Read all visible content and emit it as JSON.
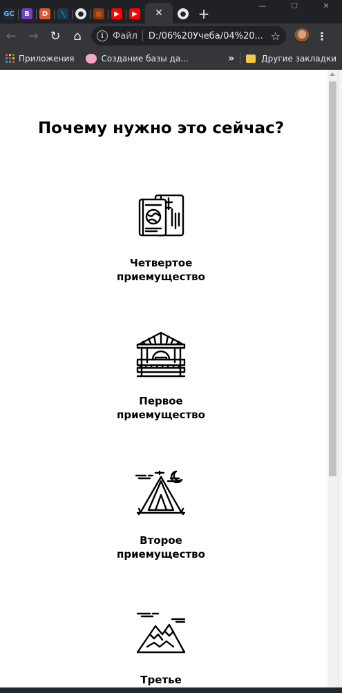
{
  "browser": {
    "tabs": [
      {
        "name": "gc",
        "text": "GC",
        "color": "#1f2b38",
        "fg": "#6fb3e8"
      },
      {
        "name": "bootstrap",
        "text": "B",
        "color": "#6f42c1",
        "fg": "#ffffff"
      },
      {
        "name": "duckduckgo",
        "text": "D",
        "color": "#de5833",
        "fg": "#ffffff"
      },
      {
        "name": "vscode",
        "text": "╲",
        "color": "#1b3b52",
        "fg": "#2fb0d6"
      },
      {
        "name": "globe",
        "text": "●",
        "color": "#202124",
        "fg": "#e8eaed"
      },
      {
        "name": "brown",
        "text": "■",
        "color": "#8b3a14",
        "fg": "#c0551e"
      },
      {
        "name": "youtube-1",
        "text": "▶",
        "color": "#ff0000",
        "fg": "#ffffff"
      },
      {
        "name": "youtube-2",
        "text": "▶",
        "color": "#ff0000",
        "fg": "#ffffff"
      }
    ],
    "active_tab_close": "✕",
    "new_tab": "+",
    "window_controls": {
      "minimize": "—",
      "maximize": "☐",
      "close": "✕"
    },
    "toolbar": {
      "back": "←",
      "forward": "→",
      "reload": "↻",
      "home": "⌂",
      "info": "i",
      "scheme_label": "Файл",
      "url": "D:/06%20Учеба/04%20...",
      "star": "☆",
      "menu": "⋮"
    },
    "bookmarks": {
      "apps_label": "Приложения",
      "item_label": "Создание базы да...",
      "overflow": "»",
      "other_label": "Другие закладки",
      "apps_colors": [
        "#ea4335",
        "#fbbc05",
        "#34a853",
        "#4285f4",
        "#ea4335",
        "#fbbc05",
        "#34a853",
        "#4285f4",
        "#ea4335"
      ]
    }
  },
  "page": {
    "heading": "Почему нужно это сейчас?",
    "features": [
      {
        "icon": "passport-ticket-icon",
        "label": "Четвертое\nприемущество"
      },
      {
        "icon": "gazebo-icon",
        "label": "Первое\nприемущество"
      },
      {
        "icon": "tent-icon",
        "label": "Второе\nприемущество"
      },
      {
        "icon": "mountain-icon",
        "label": "Третье"
      }
    ]
  }
}
